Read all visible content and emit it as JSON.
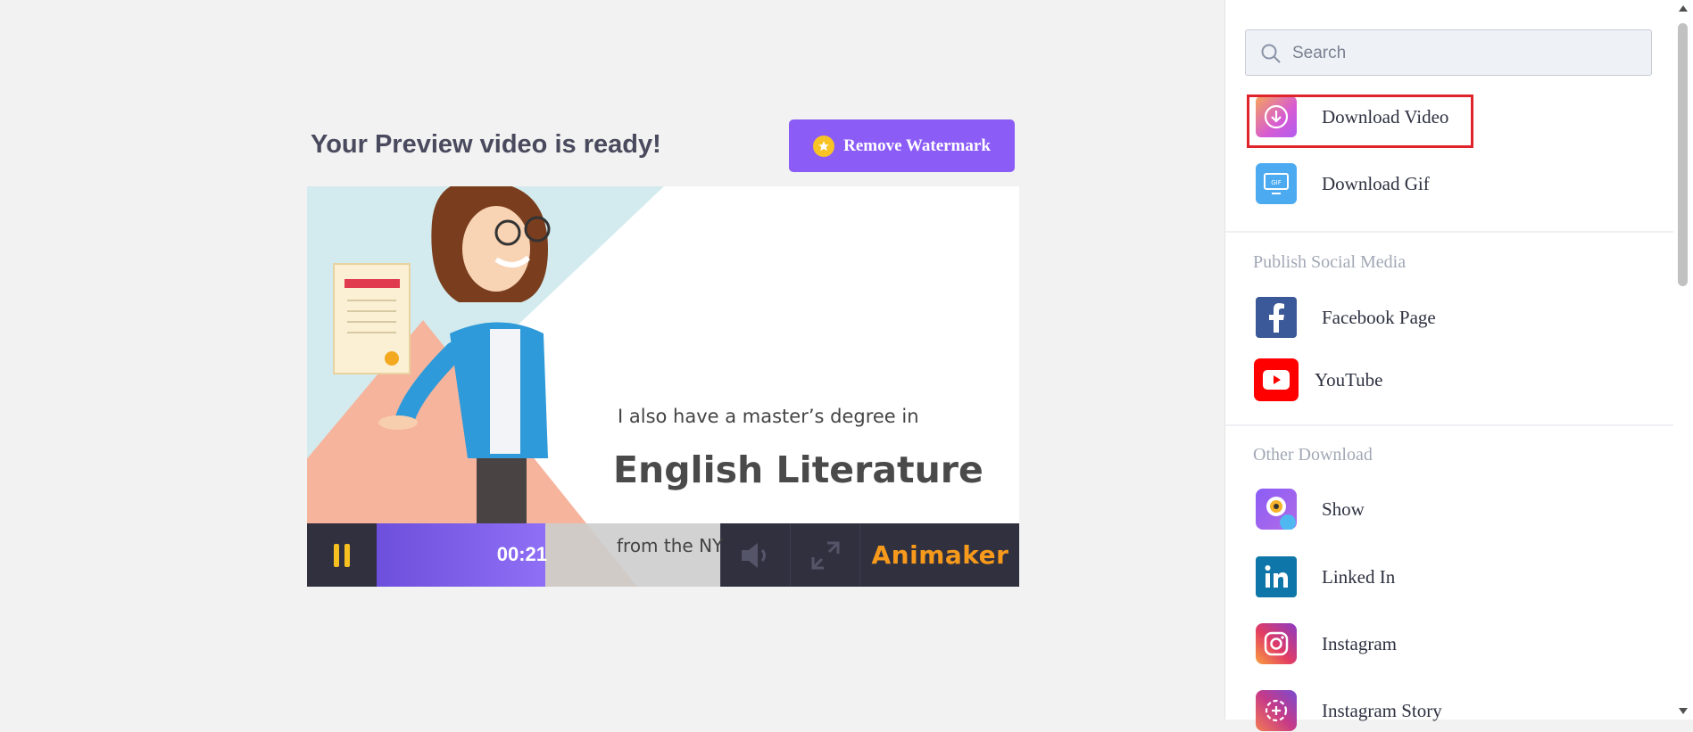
{
  "header": {
    "title": "Your Preview video is ready!",
    "watermark_button": "Remove Watermark"
  },
  "video": {
    "text_line1": "I also have a master’s degree in",
    "text_line2": "English Literature",
    "text_line3": "from the NY",
    "time": "00:21",
    "progress_fraction": 0.49,
    "brand": "Animaker"
  },
  "sidebar": {
    "search_placeholder": "Search",
    "download_items": [
      {
        "label": "Download Video",
        "icon": "download-icon"
      },
      {
        "label": "Download Gif",
        "icon": "gif-icon"
      }
    ],
    "social_title": "Publish Social Media",
    "social_items": [
      {
        "label": "Facebook Page",
        "icon": "facebook-icon"
      },
      {
        "label": "YouTube",
        "icon": "youtube-icon"
      }
    ],
    "other_title": "Other Download",
    "other_items": [
      {
        "label": "Show",
        "icon": "show-icon"
      },
      {
        "label": "Linked In",
        "icon": "linkedin-icon"
      },
      {
        "label": "Instagram",
        "icon": "instagram-icon"
      },
      {
        "label": "Instagram Story",
        "icon": "instagram-story-icon"
      }
    ]
  },
  "colors": {
    "accent": "#8b5cf6",
    "highlight_border": "#e0242c",
    "brand": "#f79a1c",
    "control_bar": "#30303f"
  }
}
